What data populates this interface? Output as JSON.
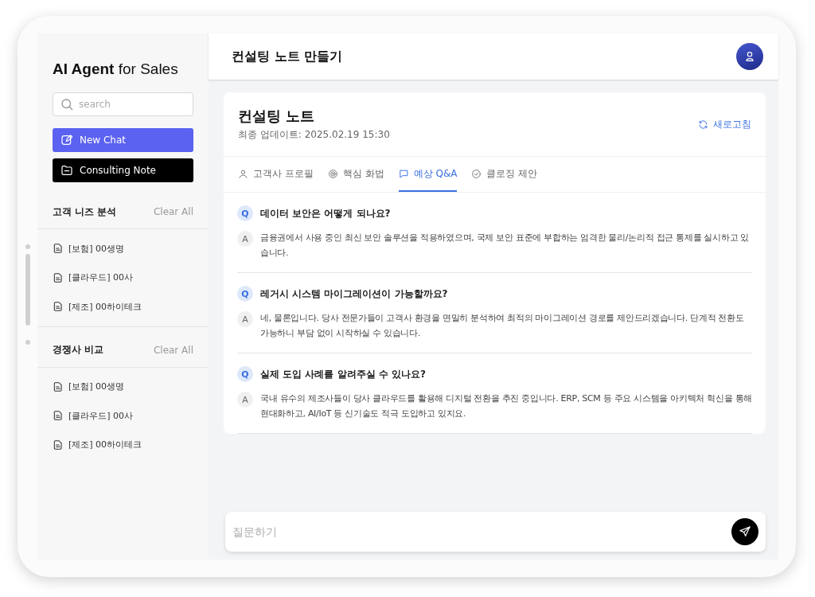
{
  "sidebar": {
    "brand_bold": "AI Agent",
    "brand_rest": "for Sales",
    "search": {
      "placeholder": "search"
    },
    "buttons": [
      {
        "label": "New Chat",
        "kind": "primary"
      },
      {
        "label": "Consulting Note",
        "kind": "dark"
      }
    ],
    "sections": [
      {
        "title": "고객 니즈 분석",
        "action": "Clear All",
        "items": [
          "[보험] 00생명",
          "[클라우드] 00사",
          "[제조] 00하이테크"
        ]
      },
      {
        "title": "경쟁사 비교",
        "action": "Clear All",
        "items": [
          "[보험] 00생명",
          "[클라우드] 00사",
          "[제조] 00하이테크"
        ]
      }
    ]
  },
  "header": {
    "title": "컨설팅 노트 만들기"
  },
  "note": {
    "title": "컨설팅 노트",
    "updated": "최종 업데이트: 2025.02.19 15:30",
    "refresh": "새로고침",
    "tabs": [
      {
        "label": "고객사 프로필",
        "kind": "profile",
        "selected": false
      },
      {
        "label": "핵심 화법",
        "kind": "pitch",
        "selected": false
      },
      {
        "label": "예상 Q&A",
        "kind": "qa",
        "selected": true
      },
      {
        "label": "클로징 제안",
        "kind": "closing",
        "selected": false
      }
    ],
    "qa": [
      {
        "q_mark": "Q",
        "question": "데이터 보안은 어떻게 되나요?",
        "a_mark": "A",
        "answer": "금융권에서 사용 중인 최신 보안 솔루션을 적용하였으며, 국제 보안 표준에 부합하는 엄격한 물리/논리적 접근 통제를 실시하고 있습니다."
      },
      {
        "q_mark": "Q",
        "question": "레거시 시스템 마이그레이션이 가능할까요?",
        "a_mark": "A",
        "answer": "네, 물론입니다. 당사 전문가들이 고객사 환경을 면밀히 분석하여 최적의 마이그레이션 경로를 제안드리겠습니다. 단계적 전환도 가능하니 부담 없이 시작하실 수 있습니다."
      },
      {
        "q_mark": "Q",
        "question": "실제 도입 사례를 알려주실 수 있나요?",
        "a_mark": "A",
        "answer": "국내 유수의 제조사들이 당사 클라우드를 활용해 디지털 전환을 추진 중입니다. ERP, SCM 등 주요 시스템을 아키텍처 혁신을 통해 현대화하고, AI/IoT 등 신기술도 적극 도입하고 있지요."
      }
    ]
  },
  "composer": {
    "placeholder": "질문하기"
  }
}
